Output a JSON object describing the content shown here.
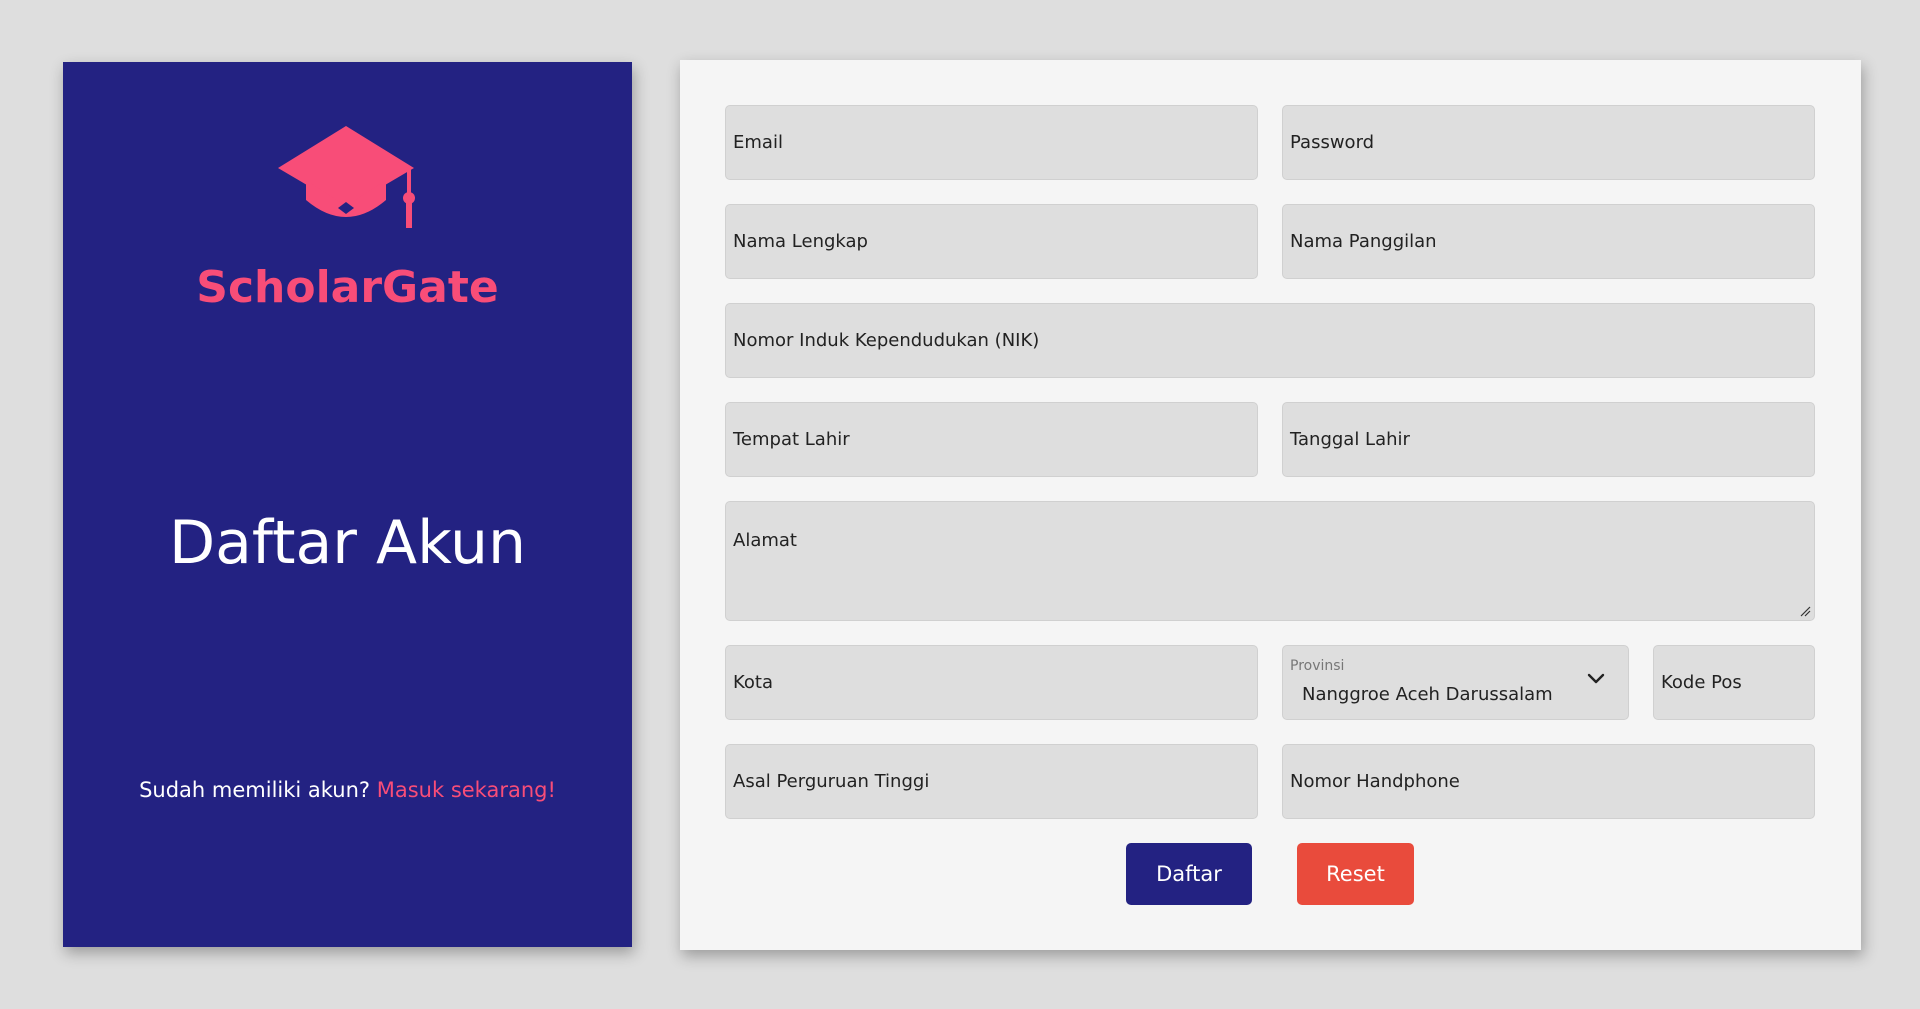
{
  "brand": {
    "name": "ScholarGate",
    "logo_icon": "graduation-cap-icon",
    "accent_color": "#f84d78",
    "panel_color": "#232282"
  },
  "panel": {
    "title": "Daftar Akun",
    "login_prompt": "Sudah memiliki akun?",
    "login_link": "Masuk sekarang!"
  },
  "form": {
    "email_placeholder": "Email",
    "password_placeholder": "Password",
    "fullname_placeholder": "Nama Lengkap",
    "nickname_placeholder": "Nama Panggilan",
    "nik_placeholder": "Nomor Induk Kependudukan (NIK)",
    "birthplace_placeholder": "Tempat Lahir",
    "birthdate_placeholder": "Tanggal Lahir",
    "address_placeholder": "Alamat",
    "city_placeholder": "Kota",
    "province_label": "Provinsi",
    "province_value": "Nanggroe Aceh Darussalam",
    "postal_placeholder": "Kode Pos",
    "university_placeholder": "Asal Perguruan Tinggi",
    "phone_placeholder": "Nomor Handphone"
  },
  "buttons": {
    "submit_label": "Daftar",
    "reset_label": "Reset",
    "submit_color": "#232282",
    "reset_color": "#e94b3c"
  }
}
